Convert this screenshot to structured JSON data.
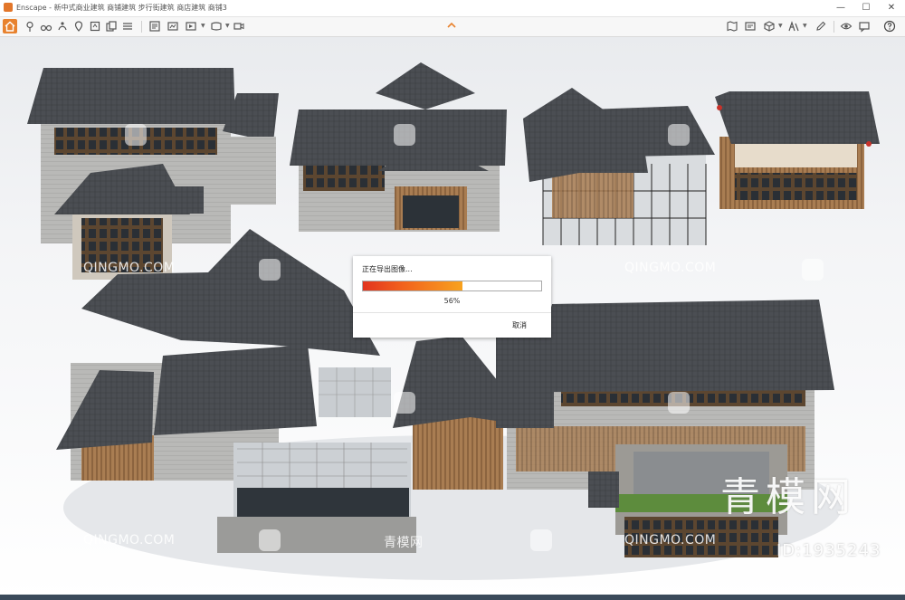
{
  "window": {
    "title": "Enscape - 新中式商业建筑 商铺建筑 步行街建筑 商店建筑 商铺3",
    "minimize_glyph": "—",
    "maximize_glyph": "☐",
    "close_glyph": "✕"
  },
  "toolbar": {
    "accent_color": "#e8822e",
    "left_icons": [
      "home-icon",
      "location-icon",
      "binoculars-icon",
      "walk-icon",
      "pin-icon",
      "library-icon",
      "copy-icon",
      "settings-icon",
      "layers-icon",
      "screenshot-icon",
      "batch-render-icon",
      "panorama-icon",
      "video-icon",
      "export-icon",
      "asset-icon"
    ],
    "right_icons": [
      "map-icon",
      "atlas-icon",
      "cube-icon",
      "materials-icon",
      "pencil-icon",
      "sun-icon",
      "eye-icon",
      "feedback-icon",
      "help-icon"
    ]
  },
  "dialog": {
    "message": "正在导出图像...",
    "progress": 0.56,
    "percent_label": "56%",
    "cancel_label": "取消"
  },
  "watermarks": {
    "site_text": "QINGMO.COM",
    "site_text_cn": "青模网",
    "brand": "青模网",
    "id_text": "ID:1935243"
  }
}
